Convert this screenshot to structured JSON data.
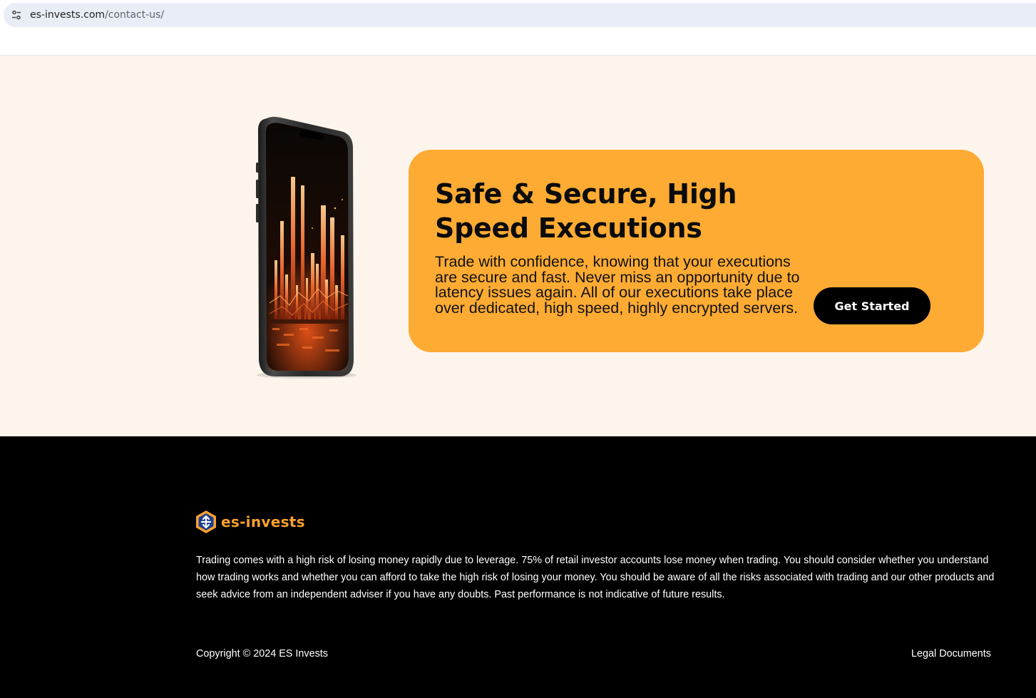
{
  "browser": {
    "url_domain": "es-invests.com",
    "url_path": "/contact-us/"
  },
  "hero": {
    "title": "Safe & Secure, High Speed Executions",
    "description": "Trade with confidence, knowing that your executions are secure and fast. Never miss an opportunity due to latency issues again. All of our executions take place over dedicated, high speed, highly encrypted servers.",
    "cta_label": "Get Started"
  },
  "footer": {
    "brand_name": "es-invests",
    "disclaimer": "Trading comes with a high risk of losing money rapidly due to leverage. 75% of retail investor accounts lose money when trading. You should consider whether you understand how trading works and whether you can afford to take the high risk of losing your money. You should be aware of all the risks associated with trading and our other products and seek advice from an independent adviser if you have any doubts. Past performance is not indicative of future results.",
    "copyright": "Copyright © 2024 ES Invests",
    "legal_link": "Legal Documents"
  },
  "colors": {
    "hero_background": "#fdf5ec",
    "cta_card": "#fdab33",
    "button": "#000000",
    "brand_accent": "#f9a12e",
    "footer_background": "#000000"
  },
  "icons": {
    "site_info": "tune-icon",
    "brand_logo": "es-invests-logo-icon",
    "phone_image": "phone-chart-image"
  }
}
